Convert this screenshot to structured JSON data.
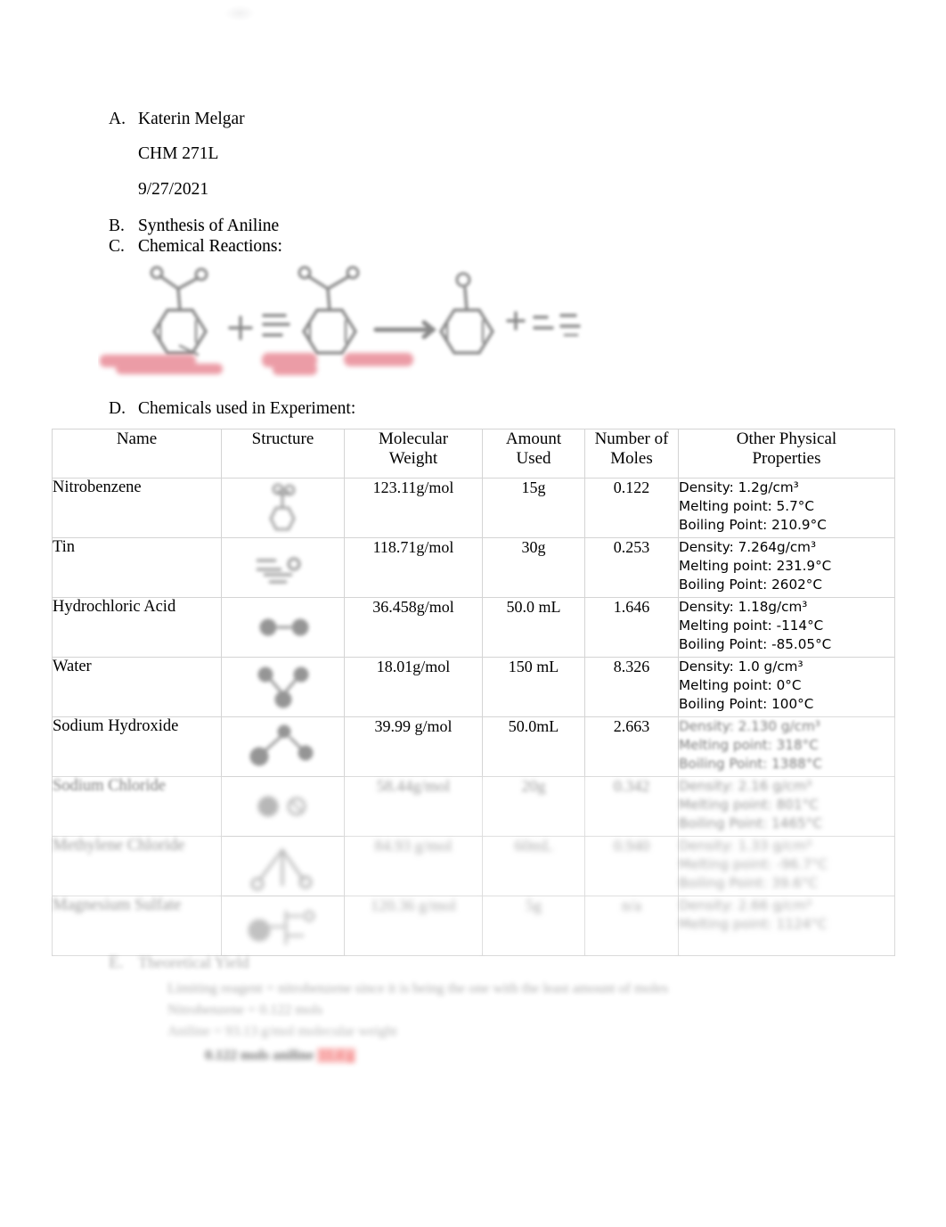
{
  "document": {
    "outline": {
      "a": {
        "marker": "A.",
        "name": "Katerin Melgar",
        "course": "CHM 271L",
        "date": "9/27/2021"
      },
      "b": {
        "marker": "B.",
        "label": "Synthesis of Aniline"
      },
      "c": {
        "marker": "C.",
        "label": "Chemical Reactions:"
      },
      "d": {
        "marker": "D.",
        "label": "Chemicals used in Experiment:"
      },
      "e": {
        "marker": "E.",
        "label": "Theoretical Yield"
      }
    },
    "reaction_scheme": {
      "caption_labels": [
        "nitrobenzene",
        "tin",
        "HCl"
      ],
      "label_color": "#e06070"
    },
    "table": {
      "headers": [
        "Name",
        "Structure",
        "Molecular Weight",
        "Amount Used",
        "Number of Moles",
        "Other Physical Properties"
      ],
      "header_lines": [
        [
          "Name"
        ],
        [
          "Structure"
        ],
        [
          "Molecular",
          "Weight"
        ],
        [
          "Amount",
          "Used"
        ],
        [
          "Number of",
          "Moles"
        ],
        [
          "Other Physical",
          "Properties"
        ]
      ],
      "rows": [
        {
          "name": "Nitrobenzene",
          "structure_icon": "nitrobenzene-structure",
          "molecular_weight": "123.11g/mol",
          "amount_used": "15g",
          "moles": "0.122",
          "properties": [
            "Density: 1.2g/cm³",
            "Melting point: 5.7°C",
            "Boiling Point: 210.9°C"
          ],
          "legible": true
        },
        {
          "name": "Tin",
          "structure_icon": "tin-structure",
          "molecular_weight": "118.71g/mol",
          "amount_used": "30g",
          "moles": "0.253",
          "properties": [
            "Density: 7.264g/cm³",
            "Melting point: 231.9°C",
            "Boiling Point: 2602°C"
          ],
          "legible": true
        },
        {
          "name": "Hydrochloric Acid",
          "structure_icon": "hydrochloric-acid-structure",
          "molecular_weight": "36.458g/mol",
          "amount_used": "50.0 mL",
          "moles": "1.646",
          "properties": [
            "Density: 1.18g/cm³",
            "Melting point: -114°C",
            "Boiling Point: -85.05°C"
          ],
          "legible": true
        },
        {
          "name": "Water",
          "structure_icon": "water-structure",
          "molecular_weight": "18.01g/mol",
          "amount_used": "150 mL",
          "moles": "8.326",
          "properties": [
            "Density: 1.0 g/cm³",
            "Melting point: 0°C",
            "Boiling Point: 100°C"
          ],
          "legible": true
        },
        {
          "name": "Sodium Hydroxide",
          "structure_icon": "sodium-hydroxide-structure",
          "molecular_weight": "39.99 g/mol",
          "amount_used": "50.0mL",
          "moles": "2.663",
          "properties": [
            "Density: 2.130 g/cm³",
            "Melting point: 318°C",
            "Boiling Point: 1388°C"
          ],
          "legible": true
        },
        {
          "name": "Sodium Chloride",
          "structure_icon": "sodium-chloride-structure",
          "molecular_weight": "58.44g/mol",
          "amount_used": "20g",
          "moles": "0.342",
          "properties": [
            "Density: 2.16 g/cm³",
            "Melting point: 801°C",
            "Boiling Point: 1465°C"
          ],
          "legible": false
        },
        {
          "name": "Methylene Chloride",
          "structure_icon": "methylene-chloride-structure",
          "molecular_weight": "84.93 g/mol",
          "amount_used": "60mL",
          "moles": "0.940",
          "properties": [
            "Density: 1.33 g/cm³",
            "Melting point: -96.7°C",
            "Boiling Point: 39.6°C"
          ],
          "legible": false
        },
        {
          "name": "Magnesium Sulfate",
          "structure_icon": "magnesium-sulfate-structure",
          "molecular_weight": "120.36 g/mol",
          "amount_used": "5g",
          "moles": "n/a",
          "properties": [
            "Density: 2.66 g/cm³",
            "Melting point: 1124°C"
          ],
          "legible": false
        }
      ]
    },
    "notes": {
      "items": [
        "Limiting reagent = nitrobenzene since it is being the one with the least amount of moles",
        "Nitrobenzene = 0.122 mols",
        "Aniline = 93.13 g/mol molecular weight"
      ],
      "final_line_black": "0.122 mols aniline",
      "final_line_red": "11.4 g"
    }
  }
}
